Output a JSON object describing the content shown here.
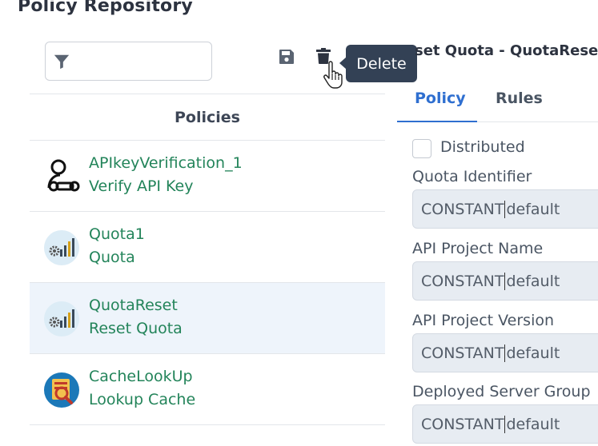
{
  "page": {
    "title": "Policy Repository"
  },
  "toolbar": {
    "filter_placeholder": "",
    "tooltip": "Delete"
  },
  "list": {
    "header": "Policies",
    "items": [
      {
        "name": "APIkeyVerification_1",
        "type": "Verify API Key",
        "icon": "key-user-icon"
      },
      {
        "name": "Quota1",
        "type": "Quota",
        "icon": "quota-chart-icon"
      },
      {
        "name": "QuotaReset",
        "type": "Reset Quota",
        "icon": "quota-reset-icon",
        "selected": true
      },
      {
        "name": "CacheLookUp",
        "type": "Lookup Cache",
        "icon": "cache-lookup-icon"
      }
    ]
  },
  "detail": {
    "title": "set Quota - QuotaReset",
    "tabs": [
      "Policy",
      "Rules"
    ],
    "active_tab": "Policy",
    "distributed_label": "Distributed",
    "fields": [
      {
        "label": "Quota Identifier",
        "value_prefix": "CONSTANT",
        "value_suffix": "default"
      },
      {
        "label": "API Project Name",
        "value_prefix": "CONSTANT",
        "value_suffix": "default"
      },
      {
        "label": "API Project Version",
        "value_prefix": "CONSTANT",
        "value_suffix": "default"
      },
      {
        "label": "Deployed Server Group",
        "value_prefix": "CONSTANT",
        "value_suffix": "default"
      }
    ]
  },
  "colors": {
    "accent": "#2f6fd0",
    "link_green": "#23845a",
    "tooltip_bg": "#334155",
    "selected_row": "#eef4fb"
  }
}
